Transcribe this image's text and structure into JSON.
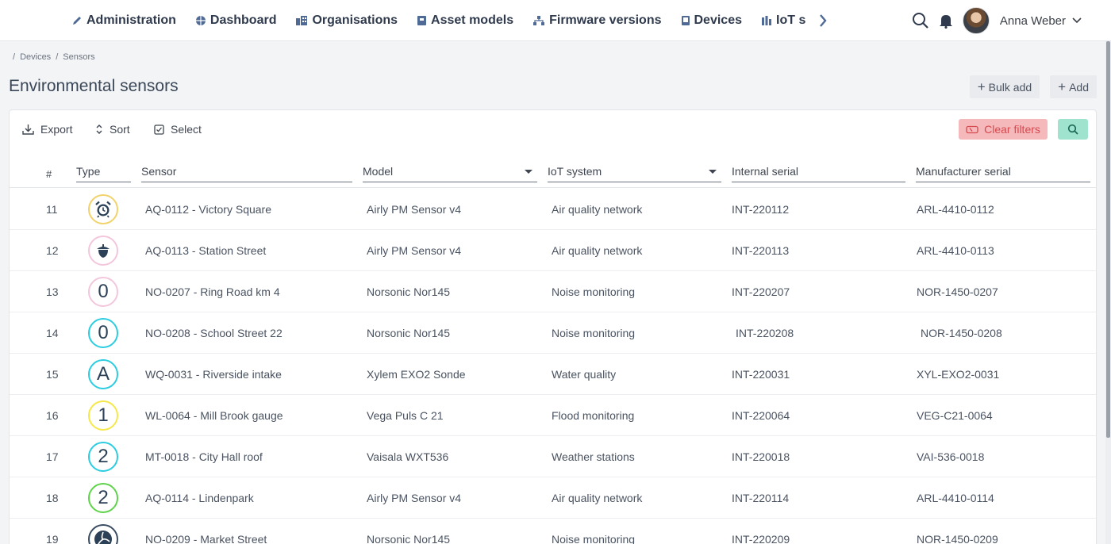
{
  "nav": {
    "items": [
      {
        "id": "administration",
        "label": "Administration",
        "icon": "pencil-icon"
      },
      {
        "id": "dashboard",
        "label": "Dashboard",
        "icon": "globe-icon"
      },
      {
        "id": "organisations",
        "label": "Organisations",
        "icon": "buildings-icon"
      },
      {
        "id": "asset-models",
        "label": "Asset models",
        "icon": "asset-icon"
      },
      {
        "id": "firmware",
        "label": "Firmware versions",
        "icon": "network-icon"
      },
      {
        "id": "devices",
        "label": "Devices",
        "icon": "device-icon"
      },
      {
        "id": "iot",
        "label": "IoT s",
        "icon": "chart-icon"
      }
    ]
  },
  "user": {
    "name": "Anna Weber"
  },
  "breadcrumb": [
    "/",
    "Devices",
    "/",
    "Sensors"
  ],
  "page": {
    "title": "Environmental sensors",
    "bulk_add": "Bulk add",
    "add": "Add"
  },
  "toolbar": {
    "export": "Export",
    "sort": "Sort",
    "select": "Select",
    "clear_filters": "Clear filters"
  },
  "table": {
    "columns": {
      "num": "#",
      "type": "Type",
      "sensor": "Sensor",
      "model": "Model",
      "iot": "IoT system",
      "internal": "Internal serial",
      "manufacturer": "Manufacturer serial"
    },
    "rows": [
      {
        "num": "11",
        "badge": "alarm",
        "color": "#f2d36b",
        "sensor": "AQ-0112 - Victory Square",
        "model": "Airly PM Sensor v4",
        "iot": "Air quality network",
        "internal": "INT-220112",
        "manufacturer": "ARL-4410-0112"
      },
      {
        "num": "12",
        "badge": "acorn",
        "color": "#f4c6dc",
        "sensor": "AQ-0113 - Station Street",
        "model": "Airly PM Sensor v4",
        "iot": "Air quality network",
        "internal": "INT-220113",
        "manufacturer": "ARL-4410-0113"
      },
      {
        "num": "13",
        "badge": "0",
        "color": "#f4c6dc",
        "sensor": "NO-0207 - Ring Road km 4",
        "model": "Norsonic Nor145",
        "iot": "Noise monitoring",
        "internal": "INT-220207",
        "manufacturer": "NOR-1450-0207"
      },
      {
        "num": "14",
        "badge": "0",
        "color": "#2ccde0",
        "sensor": "NO-0208 - School Street 22",
        "model": "Norsonic Nor145",
        "iot": "Noise monitoring",
        "internal": "INT-220208",
        "manufacturer": "NOR-1450-0208"
      },
      {
        "num": "15",
        "badge": "A",
        "color": "#2ccde0",
        "sensor": "WQ-0031 - Riverside intake",
        "model": "Xylem EXO2 Sonde",
        "iot": "Water quality",
        "internal": "INT-220031",
        "manufacturer": "XYL-EXO2-0031"
      },
      {
        "num": "16",
        "badge": "1",
        "color": "#f5e84a",
        "sensor": "WL-0064 - Mill Brook gauge",
        "model": "Vega Puls C 21",
        "iot": "Flood monitoring",
        "internal": "INT-220064",
        "manufacturer": "VEG-C21-0064"
      },
      {
        "num": "17",
        "badge": "2",
        "color": "#2ccde0",
        "sensor": "MT-0018 - City Hall roof",
        "model": "Vaisala WXT536",
        "iot": "Weather stations",
        "internal": "INT-220018",
        "manufacturer": "VAI-536-0018"
      },
      {
        "num": "18",
        "badge": "2",
        "color": "#5fd44a",
        "sensor": "AQ-0114 - Lindenpark",
        "model": "Airly PM Sensor v4",
        "iot": "Air quality network",
        "internal": "INT-220114",
        "manufacturer": "ARL-4410-0114"
      },
      {
        "num": "19",
        "badge": "ball",
        "color": "#3b4d63",
        "sensor": "NO-0209 - Market Street",
        "model": "Norsonic Nor145",
        "iot": "Noise monitoring",
        "internal": "INT-220209",
        "manufacturer": "NOR-1450-0209"
      }
    ]
  }
}
